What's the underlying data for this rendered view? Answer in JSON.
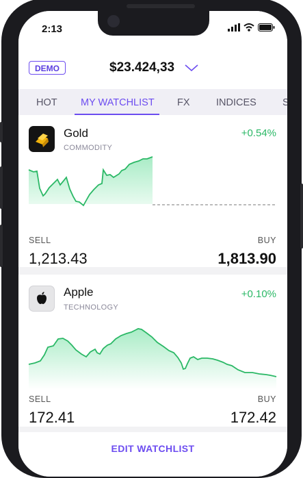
{
  "status": {
    "time": "2:13"
  },
  "header": {
    "account_badge": "DEMO",
    "balance": "$23.424,33"
  },
  "tabs": [
    {
      "label": "HOT",
      "active": false
    },
    {
      "label": "MY WATCHLIST",
      "active": true
    },
    {
      "label": "FX",
      "active": false
    },
    {
      "label": "INDICES",
      "active": false
    },
    {
      "label": "S",
      "active": false
    }
  ],
  "watchlist": [
    {
      "name": "Gold",
      "category": "COMMODITY",
      "change": "+0.54%",
      "sell_label": "SELL",
      "sell_price": "1,213.43",
      "buy_label": "BUY",
      "buy_price": "1,813.90",
      "icon": "gold-bars-icon"
    },
    {
      "name": "Apple",
      "category": "TECHNOLOGY",
      "change": "+0.10%",
      "sell_label": "SELL",
      "sell_price": "172.41",
      "buy_label": "BUY",
      "buy_price": "172.42",
      "icon": "apple-logo-icon"
    }
  ],
  "footer": {
    "edit_label": "EDIT WATCHLIST"
  },
  "colors": {
    "accent": "#6c4cf0",
    "positive": "#2bb866",
    "sparkline_fill": "#d3f5e1"
  }
}
